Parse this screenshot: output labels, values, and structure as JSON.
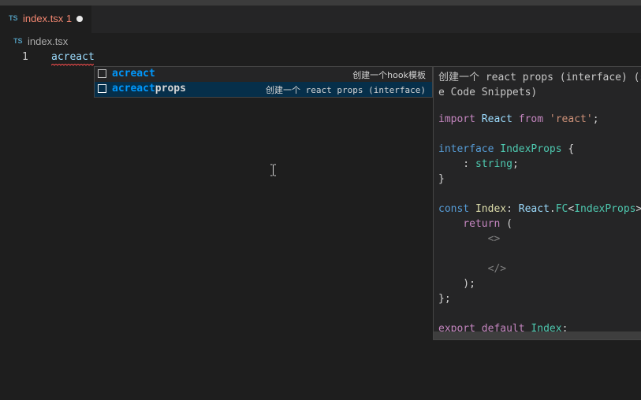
{
  "tab": {
    "badge": "TS",
    "title": "index.tsx 1"
  },
  "breadcrumb": {
    "badge": "TS",
    "file": "index.tsx"
  },
  "editor": {
    "line_number": "1",
    "line_text": "acreact"
  },
  "suggestions": [
    {
      "match": "acreact",
      "rest": "",
      "detail": "创建一个hook模板"
    },
    {
      "match": "acreact",
      "rest": "props",
      "detail": "创建一个 react props (interface)"
    }
  ],
  "details": {
    "doc_line1": "创建一个 react props (interface) (s",
    "doc_line2": "e Code Snippets)",
    "code": {
      "l1_import": "import",
      "l1_react": "React",
      "l1_from": "from",
      "l1_str": "'react'",
      "l1_semi": ";",
      "l2_kw": "interface",
      "l2_name": "IndexProps",
      "l2_brace": " {",
      "l3_colon": "    : ",
      "l3_type": "string",
      "l3_semi": ";",
      "l4": "}",
      "l5_const": "const",
      "l5_name": "Index",
      "l5_colon": ": ",
      "l5_react": "React",
      "l5_dot": ".",
      "l5_fc": "FC",
      "l5_lt": "<",
      "l5_props": "IndexProps",
      "l5_gt": ">",
      "l6_return": "    return",
      "l6_paren": " (",
      "l7": "        <>",
      "l8": "        </>",
      "l9": "    );",
      "l10": "};",
      "l11_export": "export",
      "l11_default": "default",
      "l11_name": "Index",
      "l11_semi": ";"
    }
  },
  "colors": {
    "tab_title": "#f48771",
    "ts_badge": "#519aba",
    "match_highlight": "#0097fb",
    "selected_row": "#062f4a"
  }
}
